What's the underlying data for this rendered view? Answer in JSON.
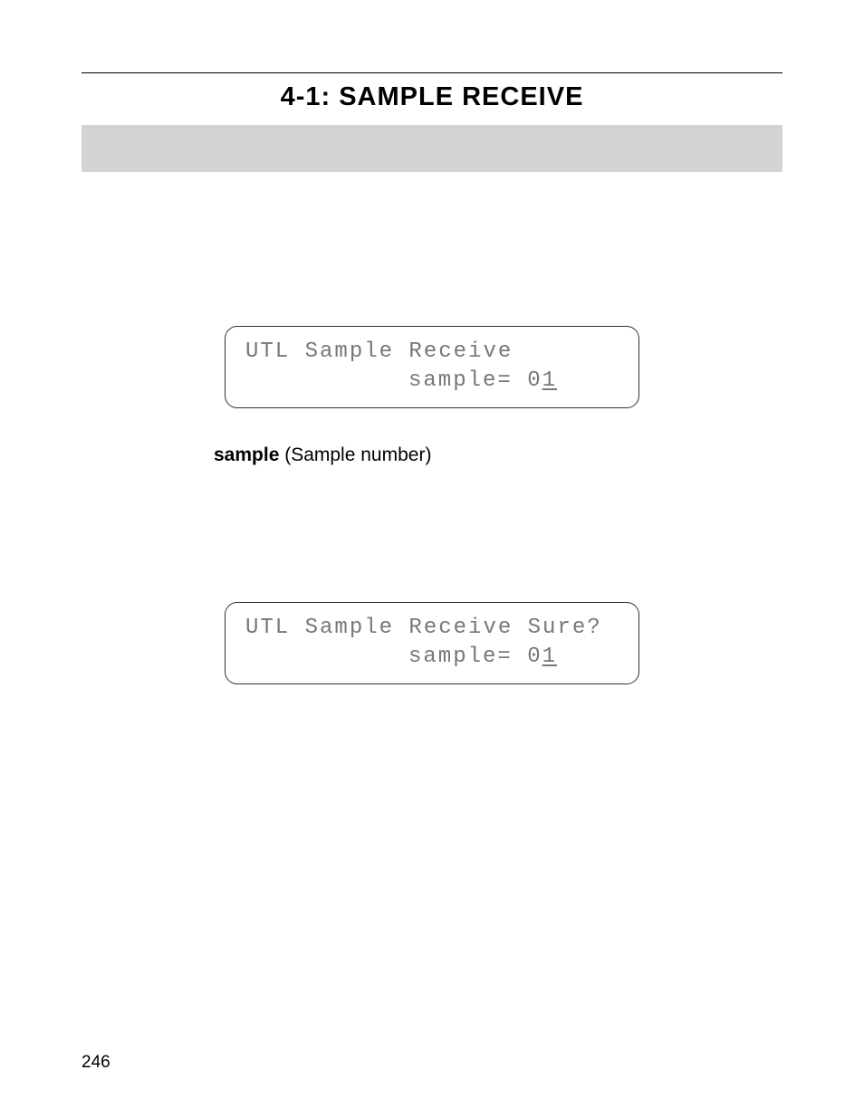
{
  "title": "4-1: SAMPLE RECEIVE",
  "lcd1": {
    "line1": "UTL Sample Receive",
    "line2_prefix": "sample= 0",
    "line2_cursor": "1"
  },
  "param": {
    "bold": "sample",
    "rest": " (Sample number)"
  },
  "lcd2": {
    "line1": "UTL Sample Receive Sure?",
    "line2_prefix": "sample= 0",
    "line2_cursor": "1"
  },
  "page_number": "246"
}
